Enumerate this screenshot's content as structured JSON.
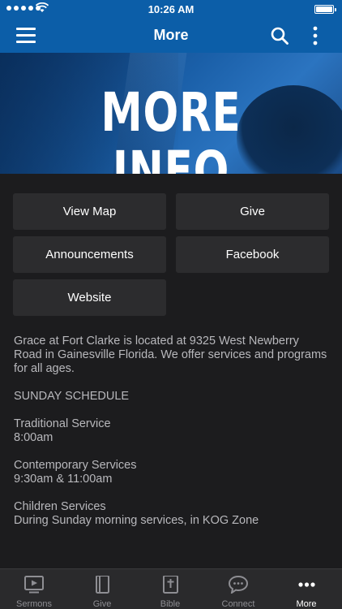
{
  "status_bar": {
    "time": "10:26 AM"
  },
  "nav_bar": {
    "title": "More"
  },
  "banner": {
    "title": "MORE INFO"
  },
  "buttons": {
    "view_map": "View Map",
    "give": "Give",
    "announcements": "Announcements",
    "facebook": "Facebook",
    "website": "Website"
  },
  "info": {
    "description": "Grace at Fort Clarke is located at 9325 West Newberry Road in Gainesville Florida. We offer services and programs for all ages.",
    "schedule_heading": "SUNDAY SCHEDULE",
    "traditional_label": "Traditional Service",
    "traditional_time": "8:00am",
    "contemporary_label": "Contemporary Services",
    "contemporary_time": "9:30am & 11:00am",
    "children_label": "Children Services",
    "children_detail": "During Sunday morning services, in KOG Zone"
  },
  "tab_bar": {
    "active": "More",
    "tabs": [
      {
        "label": "Sermons",
        "icon": "tv-icon"
      },
      {
        "label": "Give",
        "icon": "book-icon"
      },
      {
        "label": "Bible",
        "icon": "bible-icon"
      },
      {
        "label": "Connect",
        "icon": "chat-bubble-icon"
      },
      {
        "label": "More",
        "icon": "more-dots-icon"
      }
    ]
  },
  "colors": {
    "brand": "#0c5ea8",
    "background": "#1c1c1e",
    "button": "#2c2c2e",
    "tab_bar": "#2a2a2c"
  }
}
